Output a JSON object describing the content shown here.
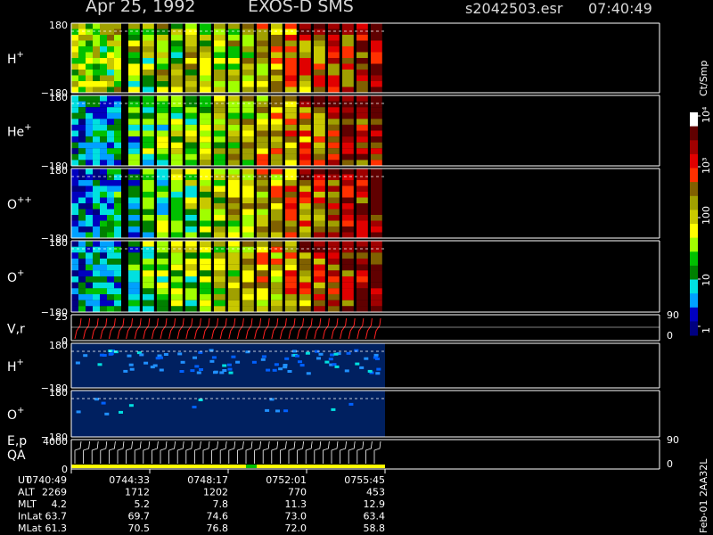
{
  "header": {
    "date": "Apr 25, 1992",
    "mission": "EXOS-D SMS",
    "file": "s2042503.esr",
    "time": "07:40:49"
  },
  "colorbar": {
    "unit": "Ct/Smp",
    "ticks": [
      "1",
      "10",
      "100",
      "10³",
      "10⁴"
    ],
    "colors": [
      "#000080",
      "#0000c0",
      "#00a0ff",
      "#00e0e0",
      "#008000",
      "#00c000",
      "#a0ff00",
      "#ffff00",
      "#c8c800",
      "#a0a000",
      "#806000",
      "#ff3000",
      "#e00000",
      "#a00000",
      "#600000",
      "#ffffff"
    ]
  },
  "footer_code": "Feb-01 2AA32L",
  "chart_data": {
    "type": "heatmap",
    "time_ticks": [
      "0740:49",
      "0744:33",
      "0748:17",
      "0752:01",
      "0755:45"
    ],
    "panels": [
      {
        "id": "h-plus-angle",
        "label_base": "H",
        "label_sup": "+",
        "ymin": "-180",
        "ymax": "180"
      },
      {
        "id": "he-plus-angle",
        "label_base": "He",
        "label_sup": "+",
        "ymin": "-180",
        "ymax": "180"
      },
      {
        "id": "o-plusplus-angle",
        "label_base": "O",
        "label_sup": "++",
        "ymin": "-180",
        "ymax": "180"
      },
      {
        "id": "o-plus-angle",
        "label_base": "O",
        "label_sup": "+",
        "ymin": "-180",
        "ymax": "180"
      },
      {
        "id": "v-r",
        "label_base": "V,r",
        "label_sup": "",
        "ymin": "0",
        "ymax": "25",
        "right_top": "90",
        "right_bottom": "0"
      },
      {
        "id": "h-plus-2",
        "label_base": "H",
        "label_sup": "+",
        "ymin": "-180",
        "ymax": "180"
      },
      {
        "id": "o-plus-2",
        "label_base": "O",
        "label_sup": "+",
        "ymin": "-180",
        "ymax": "180"
      },
      {
        "id": "e-p-qa",
        "label_base": "E,p",
        "label_line2": "QA",
        "ymin": "0",
        "ymax": "4000",
        "right_top": "90",
        "right_bottom": "0"
      }
    ],
    "ephemeris": [
      {
        "name": "UT",
        "values": [
          "0740:49",
          "0744:33",
          "0748:17",
          "0752:01",
          "0755:45"
        ]
      },
      {
        "name": "ALT",
        "values": [
          "2269",
          "1712",
          "1202",
          "770",
          "453"
        ]
      },
      {
        "name": "MLT",
        "values": [
          "4.2",
          "5.2",
          "7.8",
          "11.3",
          "12.9"
        ]
      },
      {
        "name": "InLat",
        "values": [
          "63.7",
          "69.7",
          "74.6",
          "73.0",
          "63.4"
        ]
      },
      {
        "name": "MLat",
        "values": [
          "61.3",
          "70.5",
          "76.8",
          "72.0",
          "58.8"
        ]
      }
    ]
  }
}
